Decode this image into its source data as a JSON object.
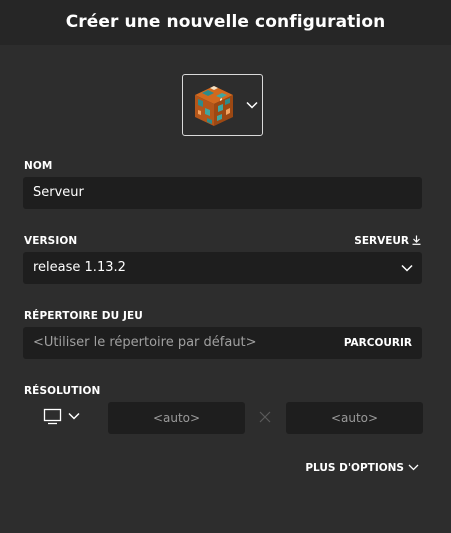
{
  "header": {
    "title": "Créer une nouvelle configuration"
  },
  "icon_picker": {
    "icon": "copper-ore-block-icon"
  },
  "name_field": {
    "label": "NOM",
    "value": "Serveur"
  },
  "version_field": {
    "label": "VERSION",
    "server_link": "SERVEUR",
    "selected": "release 1.13.2"
  },
  "game_dir_field": {
    "label": "RÉPERTOIRE DU JEU",
    "placeholder": "<Utiliser le répertoire par défaut>",
    "browse_label": "PARCOURIR"
  },
  "resolution": {
    "label": "RÉSOLUTION",
    "width_placeholder": "<auto>",
    "height_placeholder": "<auto>"
  },
  "more_options": {
    "label": "PLUS D'OPTIONS"
  },
  "colors": {
    "background": "#2d2d2d",
    "header": "#262626",
    "input": "#1e1e1e",
    "text": "#ffffff",
    "placeholder": "#a0a0a0"
  }
}
